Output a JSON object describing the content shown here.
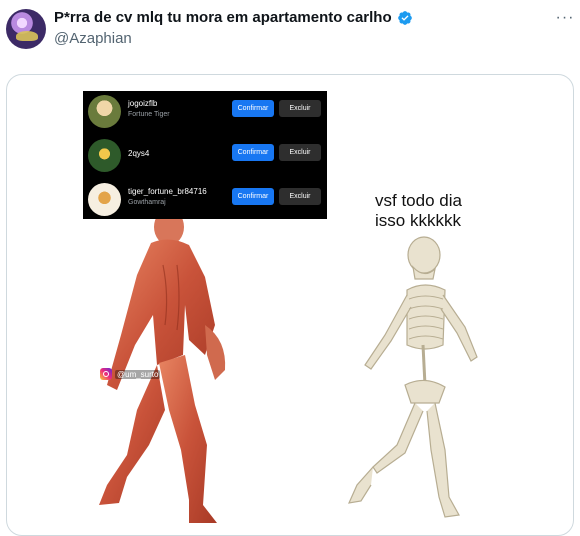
{
  "post": {
    "display_name": "P*rra de cv mlq tu mora em apartamento carlho",
    "handle": "@Azaphian",
    "more_label": "···"
  },
  "meme": {
    "requests": [
      {
        "username": "jogoizflb",
        "subtitle": "Fortune Tiger",
        "confirm": "Confirmar",
        "delete": "Excluir"
      },
      {
        "username": "2qys4",
        "subtitle": "",
        "confirm": "Confirmar",
        "delete": "Excluir"
      },
      {
        "username": "tiger_fortune_br84716",
        "subtitle": "Gowthamraj",
        "confirm": "Confirmar",
        "delete": "Excluir"
      }
    ],
    "caption": "vsf todo dia\nisso kkkkkk",
    "watermark": "@um_surto"
  },
  "colors": {
    "verified": "#1d9bf0",
    "confirm_button": "#1877f2",
    "muted_text": "#536471"
  },
  "icons": {
    "verified": "verified-badge-icon",
    "more": "more-options-icon",
    "instagram": "instagram-icon"
  }
}
